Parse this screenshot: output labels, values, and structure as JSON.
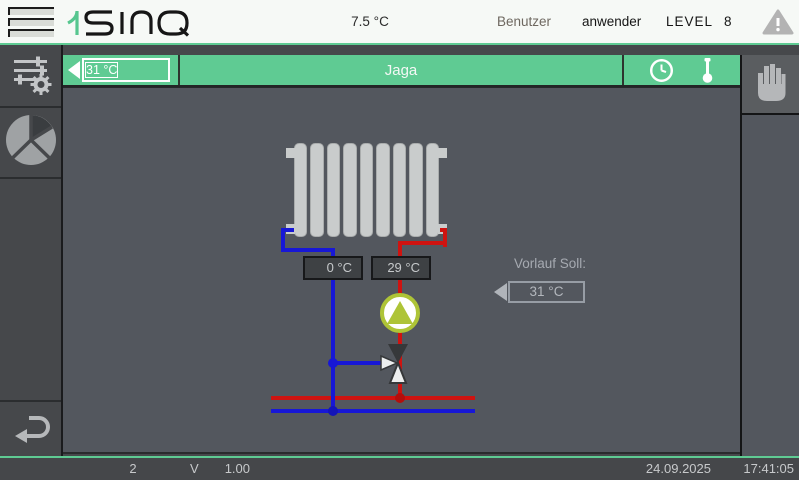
{
  "topbar": {
    "logo_text": "1sinq",
    "temperature": "7.5 °C",
    "user_label": "Benutzer",
    "user_value": "anwender",
    "level_label": "LEVEL",
    "level_value": "8"
  },
  "header": {
    "back_temperature": "31 °C",
    "title": "Jaga"
  },
  "diagram": {
    "return_temperature": "0 °C",
    "flow_temperature": "29 °C",
    "setpoint_label": "Vorlauf Soll:",
    "setpoint_value": "31 °C"
  },
  "statusbar": {
    "screen_number": "2",
    "version_label": "V",
    "version_value": "1.00",
    "date": "24.09.2025",
    "time": "17:41:05"
  },
  "colors": {
    "accent_green": "#5fcb93",
    "pipe_blue": "#1717d6",
    "pipe_red": "#cf1310",
    "pump_green": "#aec437",
    "chrome_dark": "#46484b",
    "main_background": "#53575e"
  }
}
